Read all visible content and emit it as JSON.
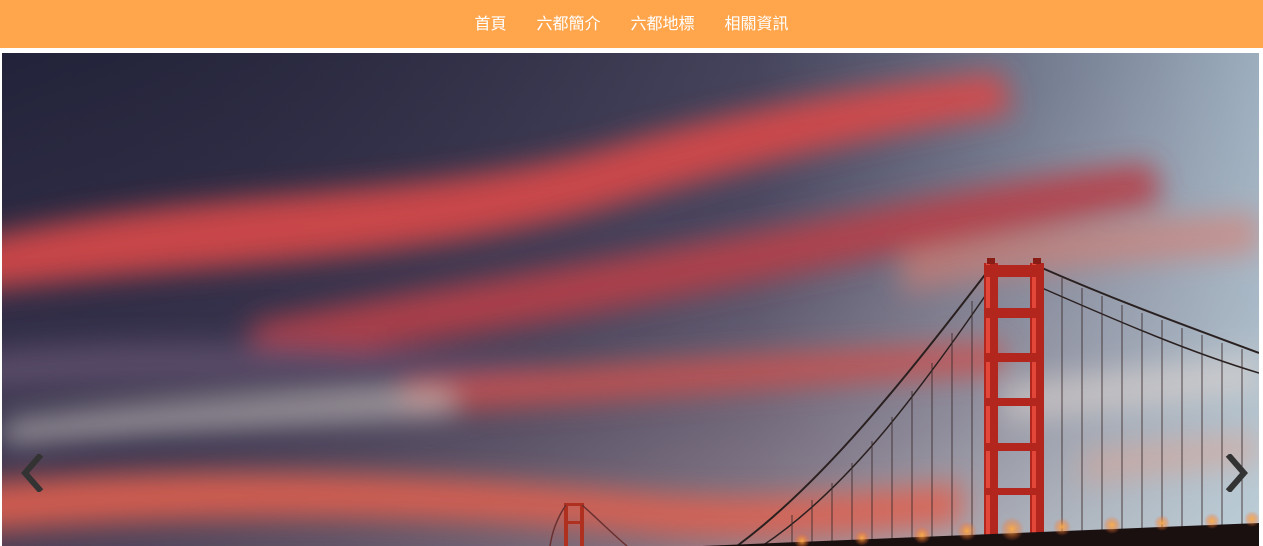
{
  "nav": {
    "items": [
      {
        "label": "首頁"
      },
      {
        "label": "六都簡介"
      },
      {
        "label": "六都地標"
      },
      {
        "label": "相關資訊"
      }
    ]
  },
  "colors": {
    "nav_background": "#ffa64d",
    "nav_text": "#ffffff"
  },
  "carousel": {
    "slide_subject": "Golden Gate Bridge at dusk under red streaked sky",
    "prev_icon": "chevron-left-icon",
    "next_icon": "chevron-right-icon"
  }
}
